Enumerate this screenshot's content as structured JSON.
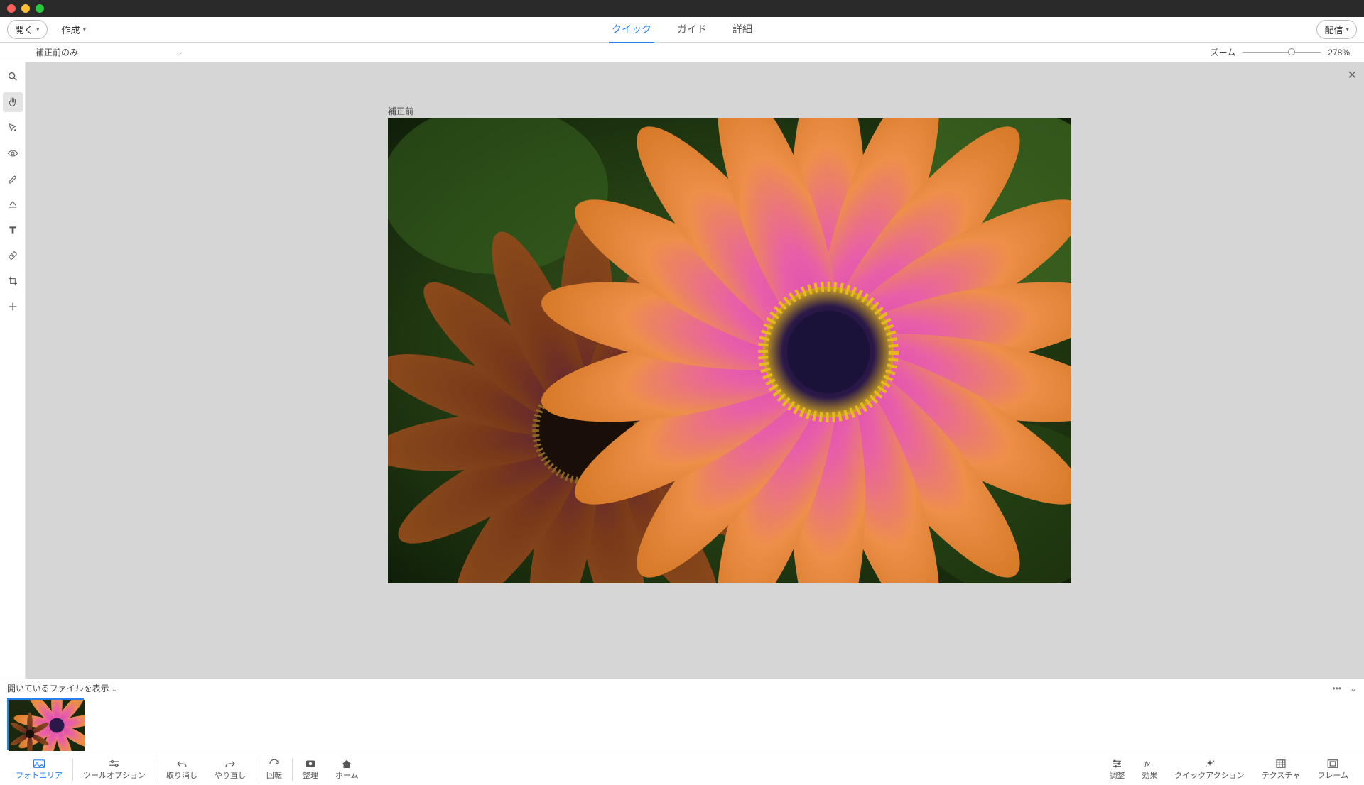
{
  "titlebar": {
    "buttons": [
      "close",
      "min",
      "max"
    ]
  },
  "topbar": {
    "open_label": "開く",
    "create_label": "作成",
    "tabs": [
      {
        "id": "quick",
        "label": "クイック",
        "active": true
      },
      {
        "id": "guided",
        "label": "ガイド",
        "active": false
      },
      {
        "id": "expert",
        "label": "詳細",
        "active": false
      }
    ],
    "share_label": "配信"
  },
  "secbar": {
    "view_label": "補正前のみ",
    "zoom_label": "ズーム",
    "zoom_value": "278%"
  },
  "tools": [
    {
      "id": "zoom",
      "name": "zoom-tool",
      "active": false
    },
    {
      "id": "hand",
      "name": "hand-tool",
      "active": true
    },
    {
      "id": "select",
      "name": "quick-select-tool",
      "active": false
    },
    {
      "id": "eye",
      "name": "redeye-tool",
      "active": false
    },
    {
      "id": "whiten",
      "name": "whiten-tool",
      "active": false
    },
    {
      "id": "hat",
      "name": "type-tool-alt",
      "active": false
    },
    {
      "id": "type",
      "name": "type-tool",
      "active": false
    },
    {
      "id": "heal",
      "name": "spot-heal-tool",
      "active": false
    },
    {
      "id": "crop",
      "name": "crop-tool",
      "active": false
    },
    {
      "id": "add",
      "name": "move-tool",
      "active": false
    }
  ],
  "canvas": {
    "label": "補正前"
  },
  "photobin": {
    "header_label": "開いているファイルを表示",
    "more_icon": "more",
    "chev_icon": "chev"
  },
  "bottombar_left": [
    {
      "id": "photoarea",
      "label": "フォトエリア",
      "active": true
    },
    {
      "id": "toolopt",
      "label": "ツールオプション"
    },
    {
      "id": "undo",
      "label": "取り消し"
    },
    {
      "id": "redo",
      "label": "やり直し"
    },
    {
      "id": "rotate",
      "label": "回転"
    },
    {
      "id": "organize",
      "label": "整理"
    },
    {
      "id": "home",
      "label": "ホーム"
    }
  ],
  "bottombar_right": [
    {
      "id": "adjust",
      "label": "調整"
    },
    {
      "id": "effects",
      "label": "効果"
    },
    {
      "id": "quickaction",
      "label": "クイックアクション"
    },
    {
      "id": "texture",
      "label": "テクスチャ"
    },
    {
      "id": "frame",
      "label": "フレーム"
    }
  ]
}
